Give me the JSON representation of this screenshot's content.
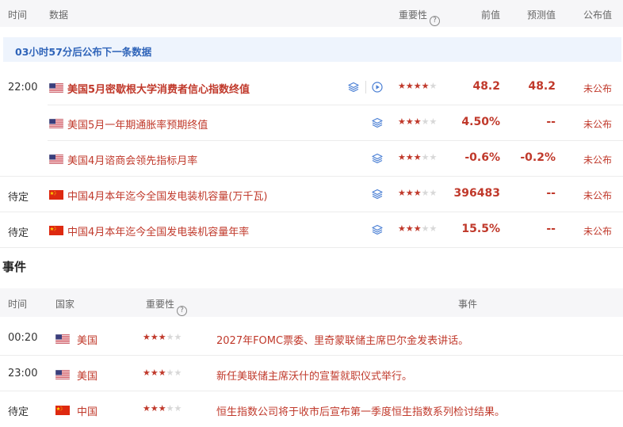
{
  "data_header": {
    "time": "时间",
    "data": "数据",
    "importance": "重要性",
    "previous": "前值",
    "forecast": "预测值",
    "published": "公布值",
    "help_glyph": "?"
  },
  "banner": {
    "text": "03小时57分后公布下一条数据"
  },
  "data_rows": [
    {
      "time": "22:00",
      "flag": "us",
      "name": "美国5月密歇根大学消费者信心指数终值",
      "bold": true,
      "stars": 4,
      "previous": "48.2",
      "forecast": "48.2",
      "published": "未公布",
      "video": true
    },
    {
      "time": "",
      "flag": "us",
      "name": "美国5月一年期通胀率预期终值",
      "bold": false,
      "stars": 3,
      "previous": "4.50%",
      "forecast": "--",
      "published": "未公布",
      "video": false
    },
    {
      "time": "",
      "flag": "us",
      "name": "美国4月谘商会领先指标月率",
      "bold": false,
      "stars": 3,
      "previous": "-0.6%",
      "forecast": "-0.2%",
      "published": "未公布",
      "video": false
    },
    {
      "time": "待定",
      "flag": "cn",
      "name": "中国4月本年迄今全国发电装机容量(万千瓦)",
      "bold": false,
      "stars": 3,
      "previous": "396483",
      "forecast": "--",
      "published": "未公布",
      "video": false
    },
    {
      "time": "待定",
      "flag": "cn",
      "name": "中国4月本年迄今全国发电装机容量年率",
      "bold": false,
      "stars": 3,
      "previous": "15.5%",
      "forecast": "--",
      "published": "未公布",
      "video": false
    }
  ],
  "events_section": {
    "title": "事件"
  },
  "events_header": {
    "time": "时间",
    "country": "国家",
    "importance": "重要性",
    "event": "事件",
    "help_glyph": "?"
  },
  "events": [
    {
      "time": "00:20",
      "flag": "us",
      "country": "美国",
      "stars": 3,
      "text": "2027年FOMC票委、里奇蒙联储主席巴尔金发表讲话。"
    },
    {
      "time": "23:00",
      "flag": "us",
      "country": "美国",
      "stars": 3,
      "text": "新任美联储主席沃什的宣誓就职仪式举行。"
    },
    {
      "time": "待定",
      "flag": "cn",
      "country": "中国",
      "stars": 3,
      "text": "恒生指数公司将于收市后宣布第一季度恒生指数系列检讨结果。"
    }
  ],
  "colors": {
    "accent_red": "#c0392b",
    "banner_blue": "#2f64b9",
    "banner_bg": "#eef4fd",
    "header_bg": "#f6f6f8",
    "icon_blue": "#4a7fd4"
  }
}
